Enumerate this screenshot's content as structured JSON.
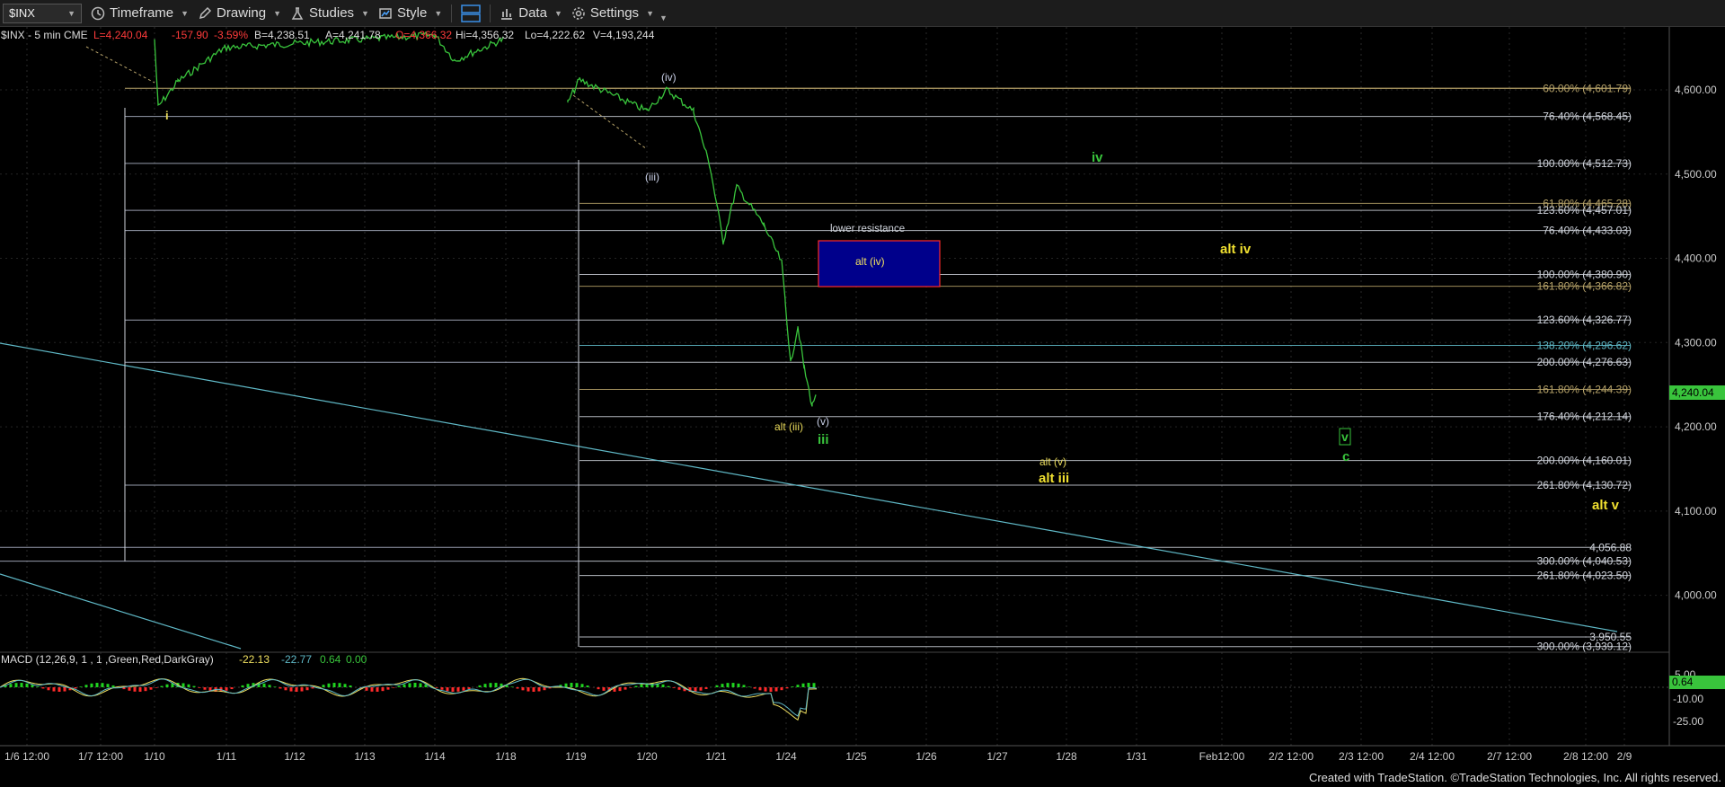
{
  "toolbar": {
    "symbol": "$INX",
    "timeframe": "Timeframe",
    "drawing": "Drawing",
    "studies": "Studies",
    "style": "Style",
    "data": "Data",
    "settings": "Settings"
  },
  "header": {
    "symbol": "$INX - 5 min  CME",
    "last": "L=4,240.04",
    "change": "-157.90",
    "pct": "-3.59%",
    "bid": "B=4,238.51",
    "ask": "A=4,241.78",
    "open": "O=4,366.32",
    "high": "Hi=4,356.32",
    "low": "Lo=4,222.62",
    "volume": "V=4,193,244"
  },
  "price_axis": {
    "ticks": [
      "4,600.00",
      "4,500.00",
      "4,400.00",
      "4,300.00",
      "4,200.00",
      "4,100.00",
      "4,000.00"
    ],
    "last_badge": "4,240.04"
  },
  "macd": {
    "title": "MACD (12,26,9, 1 , 1 ,Green,Red,DarkGray)",
    "v1": "-22.13",
    "v2": "-22.77",
    "v3": "0.64",
    "v4": "0.00",
    "ticks": [
      "5.00",
      "-10.00",
      "-25.00"
    ],
    "badge": "0.64"
  },
  "time_axis": [
    "1/6 12:00",
    "1/7 12:00",
    "1/10",
    "1/11",
    "1/12",
    "1/13",
    "1/14",
    "1/18",
    "1/19",
    "1/20",
    "1/21",
    "1/24",
    "1/25",
    "1/26",
    "1/27",
    "1/28",
    "1/31",
    "Feb12:00",
    "2/2 12:00",
    "2/3 12:00",
    "2/4 12:00",
    "2/7 12:00",
    "2/8 12:00",
    "2/9"
  ],
  "fib_labels": [
    {
      "text": "60.00% (4,601.79)",
      "price": 4601.8,
      "color": "#b8a46a"
    },
    {
      "text": "76.40% (4,568.45)",
      "price": 4568.45,
      "color": "#d0d4dc"
    },
    {
      "text": "100.00% (4,512.73)",
      "price": 4512.73,
      "color": "#d0d4dc"
    },
    {
      "text": "61.80% (4,465.28)",
      "price": 4465.28,
      "color": "#b8a46a"
    },
    {
      "text": "123.60% (4,457.01)",
      "price": 4457.01,
      "color": "#d0d4dc"
    },
    {
      "text": "76.40% (4,433.03)",
      "price": 4433.03,
      "color": "#d0d4dc"
    },
    {
      "text": "100.00% (4,380.90)",
      "price": 4380.9,
      "color": "#d0d4dc"
    },
    {
      "text": "161.80% (4,366.82)",
      "price": 4366.82,
      "color": "#b8a46a"
    },
    {
      "text": "123.60% (4,326.77)",
      "price": 4326.77,
      "color": "#d0d4dc"
    },
    {
      "text": "138.20% (4,296.62)",
      "price": 4296.62,
      "color": "#5fb8c6"
    },
    {
      "text": "200.00% (4,276.63)",
      "price": 4276.63,
      "color": "#d0d4dc"
    },
    {
      "text": "161.80% (4,244.39)",
      "price": 4244.39,
      "color": "#b8a46a"
    },
    {
      "text": "176.40% (4,212.14)",
      "price": 4212.14,
      "color": "#d0d4dc"
    },
    {
      "text": "200.00% (4,160.01)",
      "price": 4160.01,
      "color": "#d0d4dc"
    },
    {
      "text": "261.80% (4,130.72)",
      "price": 4130.72,
      "color": "#d0d4dc"
    },
    {
      "text": "4,056.88",
      "price": 4056.88,
      "color": "#d0d4dc"
    },
    {
      "text": "300.00% (4,040.53)",
      "price": 4040.53,
      "color": "#d0d4dc"
    },
    {
      "text": "261.80% (4,023.50)",
      "price": 4023.5,
      "color": "#d0d4dc"
    },
    {
      "text": "3,950.55",
      "price": 3950.55,
      "color": "#d0d4dc"
    },
    {
      "text": "300.00% (3,939.12)",
      "price": 3939.12,
      "color": "#d0d4dc"
    }
  ],
  "annotations": {
    "lower_resistance": "lower resistance",
    "alt_iv_box": "alt (iv)",
    "wave_i": "i",
    "wave_paren_iv": "(iv)",
    "wave_paren_iii": "(iii)",
    "wave_iv_green": "iv",
    "alt_iv_yellow": "alt iv",
    "alt_paren_iii": "alt (iii)",
    "wave_paren_v": "(v)",
    "wave_iii_green": "iii",
    "alt_paren_v": "alt (v)",
    "alt_iii_yellow": "alt iii",
    "wave_v_green": "v",
    "wave_c_green": "c",
    "alt_v_yellow": "alt v"
  },
  "footer": "Created with TradeStation. ©TradeStation Technologies, Inc. All rights reserved.",
  "chart_data": {
    "type": "line",
    "title": "$INX - 5 min",
    "ylim": [
      3925,
      4660
    ],
    "xlabel": "",
    "ylabel": "",
    "grid": true,
    "price_path": [
      {
        "x": "1/10",
        "y": 4660
      },
      {
        "x": "1/10",
        "y": 4580
      },
      {
        "x": "1/10",
        "y": 4610
      },
      {
        "x": "1/11",
        "y": 4650
      },
      {
        "x": "1/14",
        "y": 4665
      },
      {
        "x": "1/14",
        "y": 4635
      },
      {
        "x": "1/18",
        "y": 4660
      },
      {
        "x": "1/18",
        "y": 4600
      },
      {
        "x": "1/19",
        "y": 4585
      },
      {
        "x": "1/19",
        "y": 4612
      },
      {
        "x": "1/20",
        "y": 4575
      },
      {
        "x": "1/20",
        "y": 4600
      },
      {
        "x": "1/20",
        "y": 4575
      },
      {
        "x": "1/21",
        "y": 4510
      },
      {
        "x": "1/21",
        "y": 4420
      },
      {
        "x": "1/21",
        "y": 4485
      },
      {
        "x": "1/21",
        "y": 4440
      },
      {
        "x": "1/24",
        "y": 4395
      },
      {
        "x": "1/24",
        "y": 4350
      },
      {
        "x": "1/24",
        "y": 4275
      },
      {
        "x": "1/24",
        "y": 4320
      },
      {
        "x": "1/24",
        "y": 4270
      },
      {
        "x": "1/24",
        "y": 4225
      },
      {
        "x": "1/24",
        "y": 4240
      }
    ],
    "macd_values": {
      "macd": -22.13,
      "signal": -22.77,
      "histogram": 0.64,
      "zero": 0.0
    }
  }
}
